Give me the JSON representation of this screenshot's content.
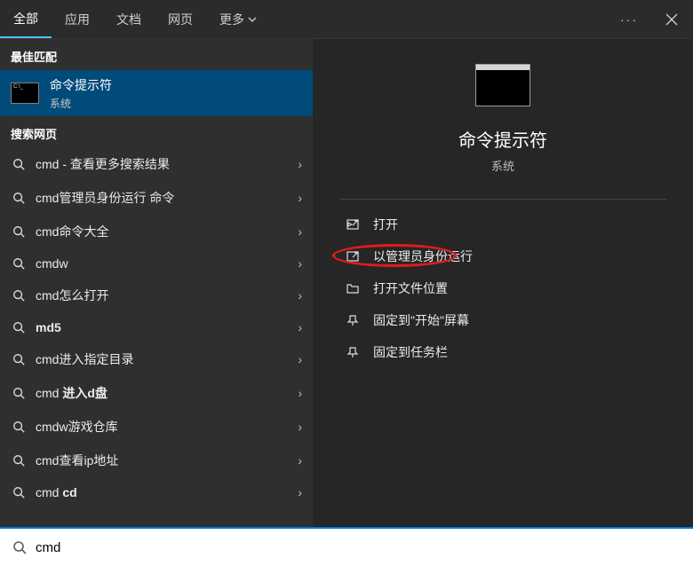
{
  "tabs": {
    "all": "全部",
    "apps": "应用",
    "docs": "文档",
    "web": "网页",
    "more": "更多"
  },
  "sections": {
    "best_match": "最佳匹配",
    "web_search": "搜索网页"
  },
  "best_match": {
    "title": "命令提示符",
    "subtitle": "系统"
  },
  "search_results": [
    {
      "prefix": "cmd",
      "suffix": " - 查看更多搜索结果",
      "bold_prefix": false
    },
    {
      "prefix": "cmd",
      "suffix": "管理员身份运行 命令",
      "bold_prefix": false
    },
    {
      "prefix": "cmd",
      "suffix": "命令大全",
      "bold_prefix": false
    },
    {
      "prefix": "cmd",
      "suffix": "w",
      "bold_prefix": false
    },
    {
      "prefix": "cmd",
      "suffix": "怎么打开",
      "bold_prefix": false
    },
    {
      "prefix": "md5",
      "suffix": "",
      "bold_prefix": true
    },
    {
      "prefix": "cmd",
      "suffix": "进入指定目录",
      "bold_prefix": false
    },
    {
      "prefix": "cmd ",
      "suffix": "进入d盘",
      "bold_prefix": false,
      "bold_suffix": true
    },
    {
      "prefix": "cmd",
      "suffix": "w游戏仓库",
      "bold_prefix": false
    },
    {
      "prefix": "cmd",
      "suffix": "查看ip地址",
      "bold_prefix": false
    },
    {
      "prefix": "cmd ",
      "suffix": "cd",
      "bold_prefix": false,
      "bold_suffix": true
    }
  ],
  "hero": {
    "title": "命令提示符",
    "subtitle": "系统"
  },
  "actions": {
    "open": "打开",
    "run_as_admin": "以管理员身份运行",
    "open_file_location": "打开文件位置",
    "pin_to_start": "固定到\"开始\"屏幕",
    "pin_to_taskbar": "固定到任务栏"
  },
  "search": {
    "value": "cmd"
  }
}
